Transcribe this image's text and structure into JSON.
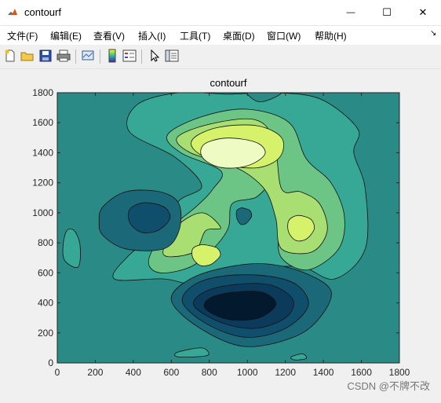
{
  "window": {
    "title": "contourf",
    "minimize_glyph": "—",
    "maximize_glyph": "☐",
    "close_glyph": "✕"
  },
  "menubar": {
    "items": [
      "文件(F)",
      "编辑(E)",
      "查看(V)",
      "插入(I)",
      "工具(T)",
      "桌面(D)",
      "窗口(W)",
      "帮助(H)"
    ],
    "dock_glyph": "↘"
  },
  "toolbar": {
    "icons": [
      "new-figure-icon",
      "open-folder-icon",
      "save-icon",
      "print-icon",
      "link-plot-icon",
      "colorbar-icon",
      "legend-icon",
      "pointer-arrow-icon",
      "property-editor-icon"
    ]
  },
  "chart_data": {
    "type": "contourf",
    "title": "contourf",
    "xlabel": "",
    "ylabel": "",
    "xlim": [
      0,
      1800
    ],
    "ylim": [
      0,
      1800
    ],
    "xticks": [
      0,
      200,
      400,
      600,
      800,
      1000,
      1200,
      1400,
      1600,
      1800
    ],
    "yticks": [
      0,
      200,
      400,
      600,
      800,
      1000,
      1200,
      1400,
      1600,
      1800
    ],
    "colormap": "parula-like",
    "colors": [
      "#031a2e",
      "#0c3a5a",
      "#0f4f6c",
      "#1a6878",
      "#2a8a86",
      "#37a896",
      "#6cc585",
      "#a9de72",
      "#d6f26a",
      "#eefcc4"
    ],
    "features": [
      {
        "kind": "peak",
        "x": 920,
        "y": 1400,
        "level": 9
      },
      {
        "kind": "peak",
        "x": 1280,
        "y": 900,
        "level": 8
      },
      {
        "kind": "peak",
        "x": 780,
        "y": 720,
        "level": 8
      },
      {
        "kind": "trough",
        "x": 480,
        "y": 970,
        "level": 2
      },
      {
        "kind": "trough",
        "x": 980,
        "y": 390,
        "level": 0
      },
      {
        "kind": "trough",
        "x": 80,
        "y": 780,
        "level": 5
      }
    ]
  },
  "watermark": "CSDN @不牌不改"
}
